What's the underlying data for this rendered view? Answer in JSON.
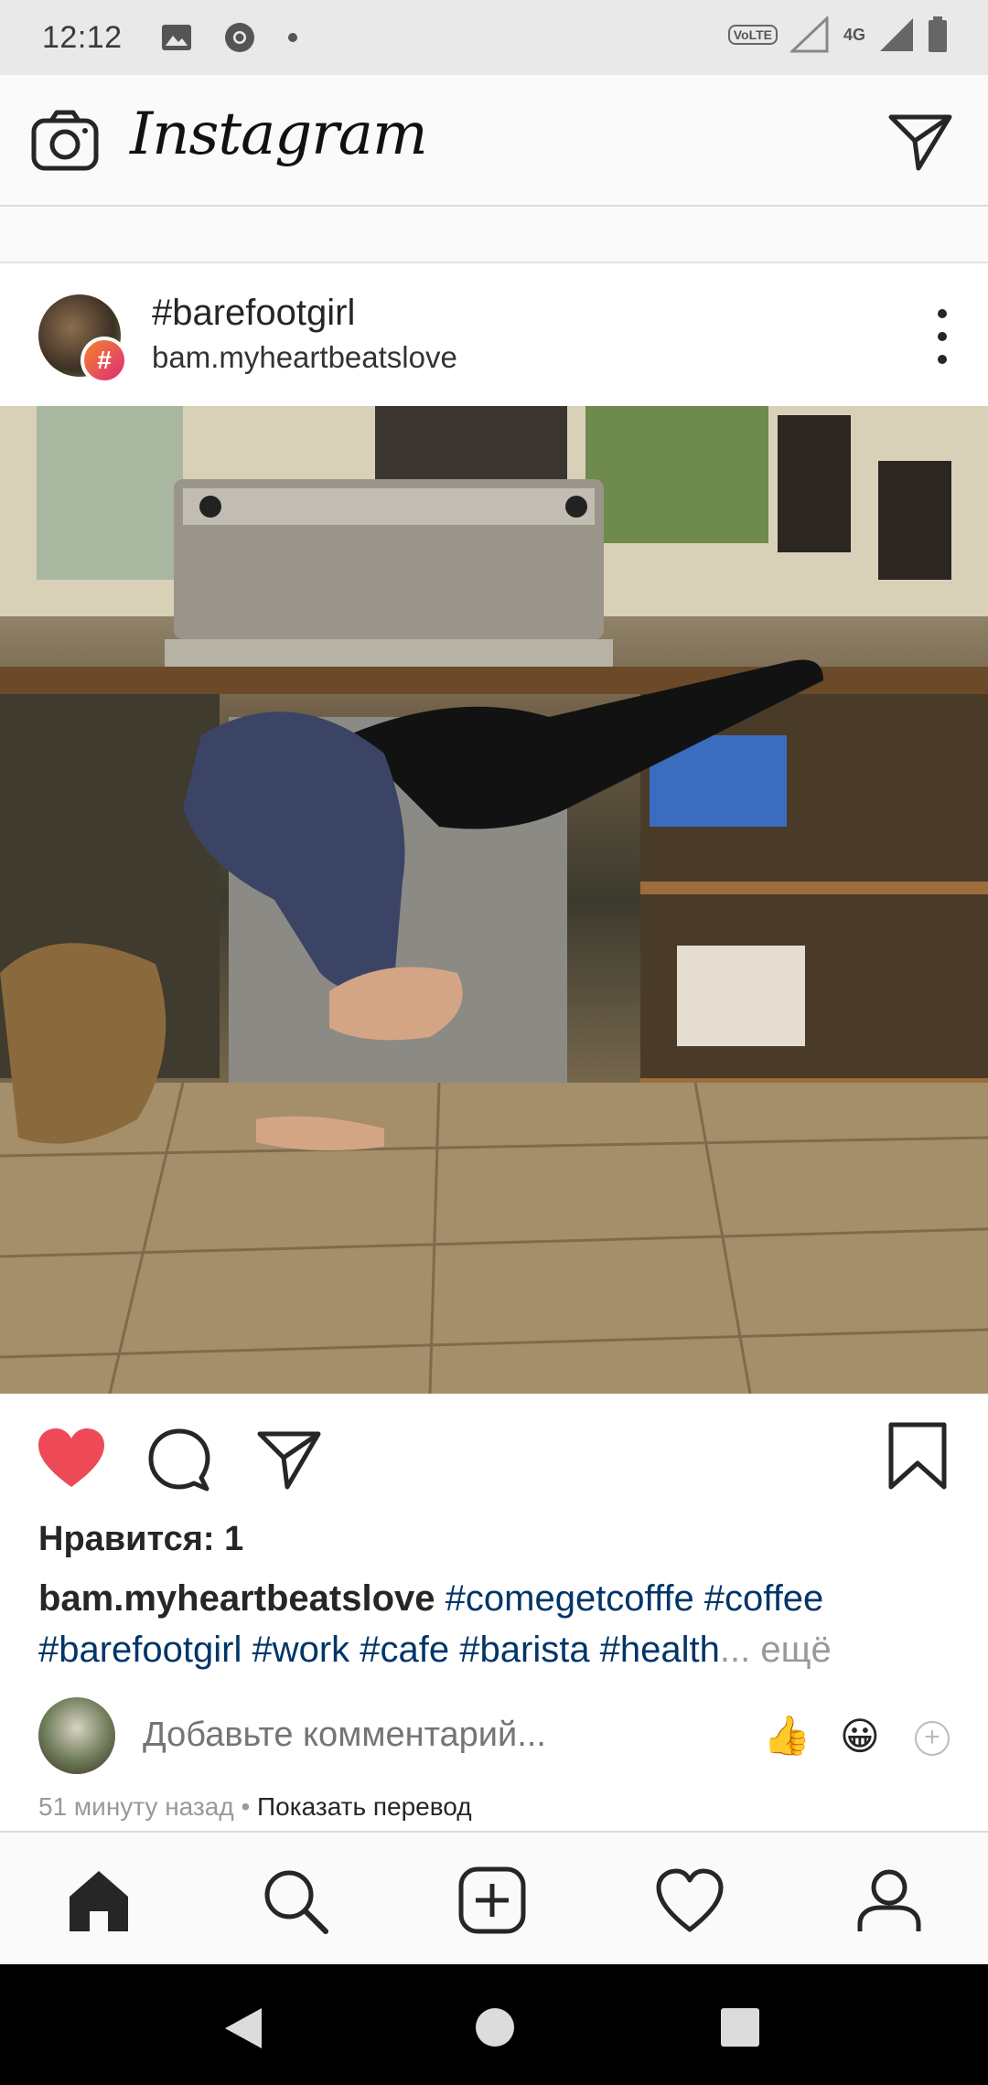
{
  "status_bar": {
    "time": "12:12",
    "volte_label": "VoLTE",
    "network_label": "4G",
    "left_icons": [
      "image-icon",
      "chrome-icon",
      "dot-icon"
    ],
    "right_icons": [
      "volte-icon",
      "signal-icon",
      "signal-icon",
      "battery-icon"
    ]
  },
  "header": {
    "logo_text": "Instagram",
    "icons": [
      "camera-icon",
      "direct-send-icon"
    ]
  },
  "post": {
    "title": "#barefootgirl",
    "subtitle": "bam.myheartbeatslove",
    "badge_symbol": "#"
  },
  "actions": {
    "icons": [
      "heart-filled-icon",
      "comment-icon",
      "share-icon",
      "bookmark-icon"
    ],
    "like_color": "#ed4956"
  },
  "likes_text": "Нравится: 1",
  "caption": {
    "username": "bam.myheartbeatslove",
    "tags_line1": "#comegetcofffe #coffee",
    "tags_line2": "#barefootgirl #work #cafe #barista #health",
    "ellipsis": "...",
    "more_label": "ещё"
  },
  "comment": {
    "placeholder": "Добавьте комментарий...",
    "emojis": [
      "👍",
      "😀"
    ]
  },
  "timestamp": {
    "time_ago": "51 минуту назад",
    "separator": "•",
    "translate_label": "Показать перевод"
  },
  "bottom_nav": {
    "items": [
      "home-icon",
      "search-icon",
      "new-post-icon",
      "activity-heart-icon",
      "profile-icon"
    ]
  },
  "system_nav": {
    "items": [
      "back-icon",
      "home-circle-icon",
      "recents-icon"
    ]
  },
  "colors": {
    "hashtag": "#003569",
    "muted": "#999999",
    "border": "#dbdbdb"
  }
}
